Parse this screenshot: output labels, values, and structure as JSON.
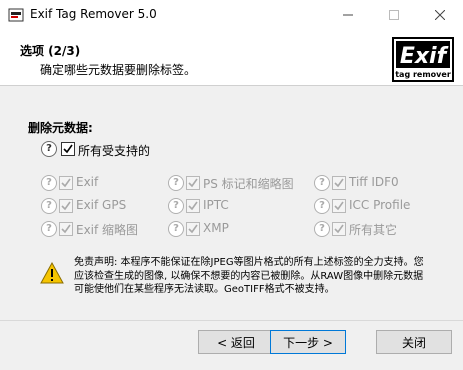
{
  "window": {
    "title": "Exif Tag Remover 5.0"
  },
  "header": {
    "step_title": "选项 (2/3)",
    "step_subtitle": "确定哪些元数据要删除标签。"
  },
  "logo": {
    "word": "Exif",
    "subword": "tag remover"
  },
  "section_label": "删除元数据:",
  "all_supported": {
    "label": "所有受支持的",
    "checked": true
  },
  "options": [
    {
      "label": "Exif",
      "checked": true,
      "enabled": false
    },
    {
      "label": "PS 标记和缩略图",
      "checked": true,
      "enabled": false
    },
    {
      "label": "Tiff IDF0",
      "checked": true,
      "enabled": false
    },
    {
      "label": "Exif GPS",
      "checked": true,
      "enabled": false
    },
    {
      "label": "IPTC",
      "checked": true,
      "enabled": false
    },
    {
      "label": "ICC Profile",
      "checked": true,
      "enabled": false
    },
    {
      "label": "Exif 缩略图",
      "checked": true,
      "enabled": false
    },
    {
      "label": "XMP",
      "checked": true,
      "enabled": false
    },
    {
      "label": "所有其它",
      "checked": true,
      "enabled": false
    }
  ],
  "disclaimer": "免责声明: 本程序不能保证在除JPEG等图片格式的所有上述标签的全力支持。您应该检查生成的图像, 以确保不想要的内容已被删除。从RAW图像中删除元数据可能使他们在某些程序无法读取。GeoTIFF格式不被支持。",
  "buttons": {
    "back": "< 返回",
    "next": "下一步 >",
    "close": "关闭"
  },
  "help_glyph": "?"
}
